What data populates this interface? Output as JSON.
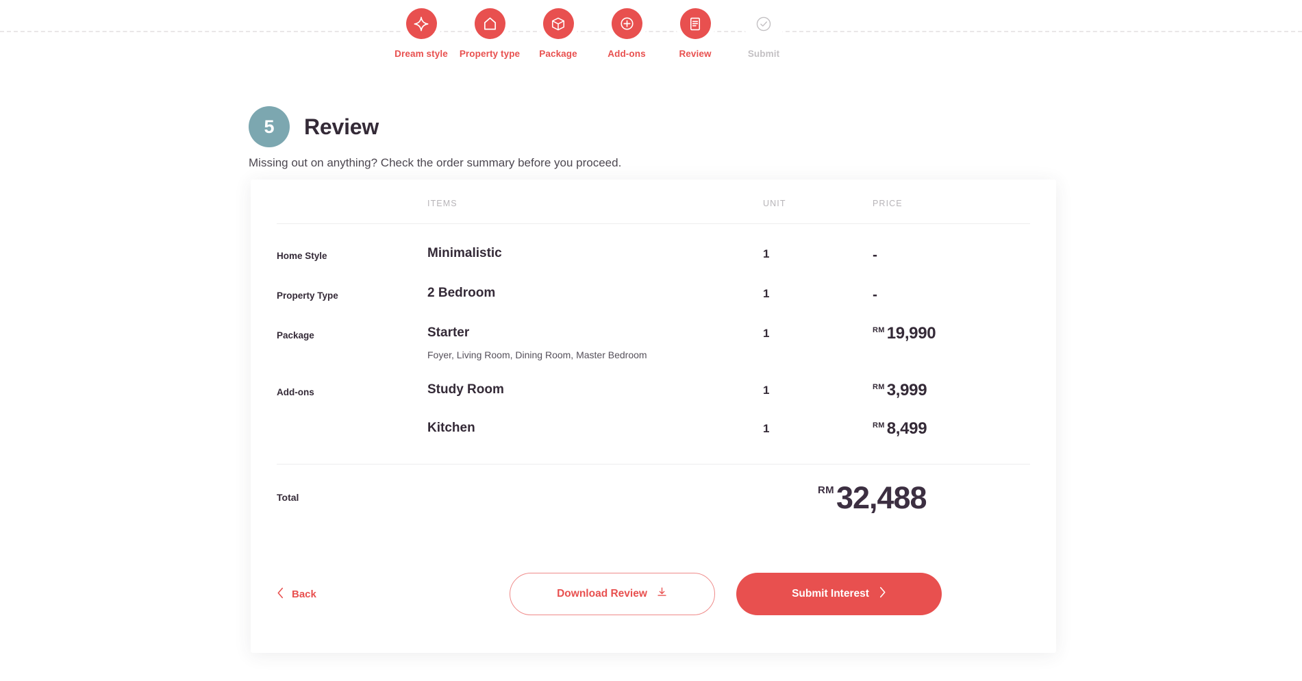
{
  "stepper": {
    "steps": [
      {
        "label": "Dream style",
        "icon": "sparkle-icon",
        "state": "done"
      },
      {
        "label": "Property type",
        "icon": "home-icon",
        "state": "done"
      },
      {
        "label": "Package",
        "icon": "box-icon",
        "state": "done"
      },
      {
        "label": "Add-ons",
        "icon": "plus-circle-icon",
        "state": "done"
      },
      {
        "label": "Review",
        "icon": "document-list-icon",
        "state": "current"
      },
      {
        "label": "Submit",
        "icon": "check-circle-icon",
        "state": "inactive"
      }
    ],
    "active_color": "#e8504f",
    "inactive_color": "#c3c0c3"
  },
  "heading": {
    "step_number": "5",
    "title": "Review",
    "subtitle": "Missing out on anything? Check the order summary before you proceed.",
    "badge_color": "#7ca7b0"
  },
  "summary": {
    "columns": {
      "label": "",
      "items": "ITEMS",
      "unit": "UNIT",
      "price": "PRICE"
    },
    "rows": [
      {
        "label": "Home Style",
        "item": "Minimalistic",
        "description": "",
        "unit": "1",
        "currency": "",
        "price": "-"
      },
      {
        "label": "Property Type",
        "item": "2 Bedroom",
        "description": "",
        "unit": "1",
        "currency": "",
        "price": "-"
      },
      {
        "label": "Package",
        "item": "Starter",
        "description": "Foyer, Living Room, Dining Room, Master Bedroom",
        "unit": "1",
        "currency": "RM",
        "price": "19,990"
      },
      {
        "label": "Add-ons",
        "item": "Study Room",
        "description": "",
        "unit": "1",
        "currency": "RM",
        "price": "3,999"
      },
      {
        "label": "",
        "item": "Kitchen",
        "description": "",
        "unit": "1",
        "currency": "RM",
        "price": "8,499"
      }
    ],
    "total": {
      "label": "Total",
      "currency": "RM",
      "amount": "32,488"
    }
  },
  "actions": {
    "back_label": "Back",
    "back_icon": "chevron-left-icon",
    "download_label": "Download Review",
    "download_icon": "download-icon",
    "submit_label": "Submit Interest",
    "submit_icon": "chevron-right-icon",
    "primary_color": "#e8504f"
  }
}
